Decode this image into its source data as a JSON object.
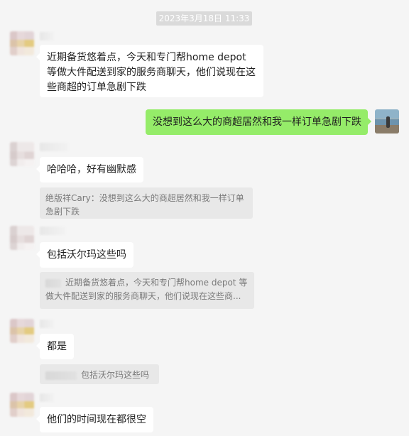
{
  "timestamp": "2023年3月18日 11:33",
  "messages": [
    {
      "id": "m1",
      "side": "left",
      "text": "近期备货悠着点，今天和专门帮home depot 等做大件配送到家的服务商聊天，他们说现在这些商超的订单急剧下跌"
    },
    {
      "id": "m2",
      "side": "right",
      "text": "没想到这么大的商超居然和我一样订单急剧下跌"
    },
    {
      "id": "m3",
      "side": "left",
      "text": "哈哈哈，好有幽默感",
      "quote": "绝版祥Cary：没想到这么大的商超居然和我一样订单急剧下跌"
    },
    {
      "id": "m4",
      "side": "left",
      "text": "包括沃尔玛这些吗",
      "quote": "近期备货悠着点，今天和专门帮home depot 等做大件配送到家的服务商聊天，他们说现在这些商..."
    },
    {
      "id": "m5",
      "side": "left",
      "text": "都是",
      "quote": "包括沃尔玛这些吗"
    },
    {
      "id": "m6",
      "side": "left",
      "text": "他们的时间现在都很空"
    }
  ],
  "colors": {
    "background": "#f5f5f5",
    "incoming_bubble": "#ffffff",
    "outgoing_bubble": "#95ec69",
    "quote_bg": "#e8e8e8"
  }
}
